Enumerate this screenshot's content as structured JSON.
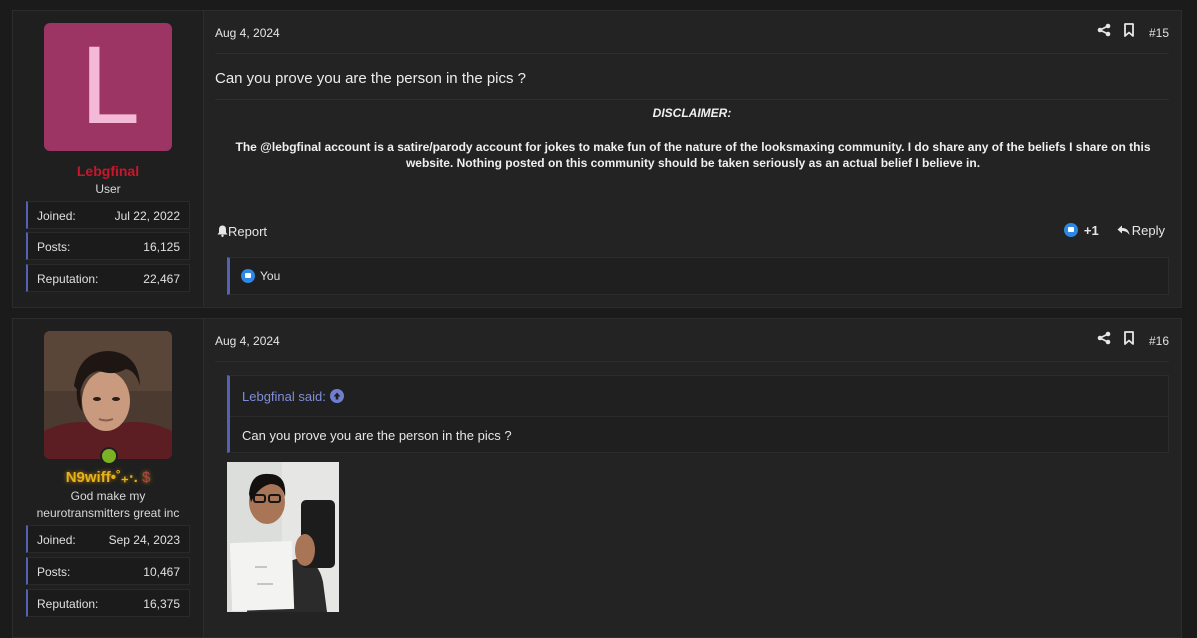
{
  "posts": [
    {
      "user": {
        "avatar_letter": "L",
        "name": "Lebgfinal",
        "title": "User",
        "stats": [
          {
            "label": "Joined:",
            "value": "Jul 22, 2022"
          },
          {
            "label": "Posts:",
            "value": "16,125"
          },
          {
            "label": "Reputation:",
            "value": "22,467"
          }
        ]
      },
      "date": "Aug 4, 2024",
      "number": "#15",
      "text": "Can you prove you are the person in the pics ?",
      "disclaimer_title": "DISCLAIMER:",
      "disclaimer_body": "The @lebgfinal account is a satire/parody account for jokes to make fun of the nature of the looksmaxing community. I do share any of the beliefs I share on this website. Nothing posted on this community should be taken seriously as an actual belief I believe in.",
      "report_label": "Report",
      "reaction_count": "+1",
      "reply_label": "Reply",
      "reacted_by": "You"
    },
    {
      "user": {
        "name": "N9wiff•˚₊‧.",
        "name_symbol": "$",
        "title": "God make my neurotransmitters great inc",
        "stats": [
          {
            "label": "Joined:",
            "value": "Sep 24, 2023"
          },
          {
            "label": "Posts:",
            "value": "10,467"
          },
          {
            "label": "Reputation:",
            "value": "16,375"
          }
        ]
      },
      "date": "Aug 4, 2024",
      "number": "#16",
      "quote_author": "Lebgfinal said:",
      "quote_text": "Can you prove you are the person in the pics ?"
    }
  ],
  "icons": [
    "share-icon",
    "bookmark-icon",
    "bell-icon",
    "like-icon",
    "reply-icon",
    "arrow-up-icon"
  ],
  "colors": {
    "accent": "#5561b4",
    "user1": "#c8172c",
    "user2": "#e6b21e",
    "online": "#7bb122",
    "like": "#2f87e4"
  }
}
